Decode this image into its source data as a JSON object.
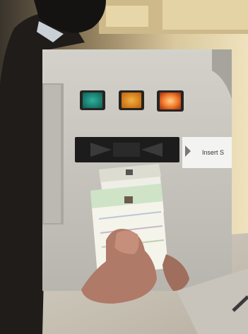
{
  "photo": {
    "machine": {
      "buttons": [
        {
          "name": "teal",
          "color": "#1f8f80"
        },
        {
          "name": "orange",
          "color": "#e08a1a"
        },
        {
          "name": "red-orange",
          "color": "#f0702a"
        }
      ],
      "slot_sign": "Insert S"
    },
    "colors": {
      "panel": "#c9c7c0",
      "panel_shadow": "#9c9a93",
      "background_wall": "#d8c79a",
      "slot": "#1c1c1c",
      "hand": "#b07a68"
    }
  }
}
